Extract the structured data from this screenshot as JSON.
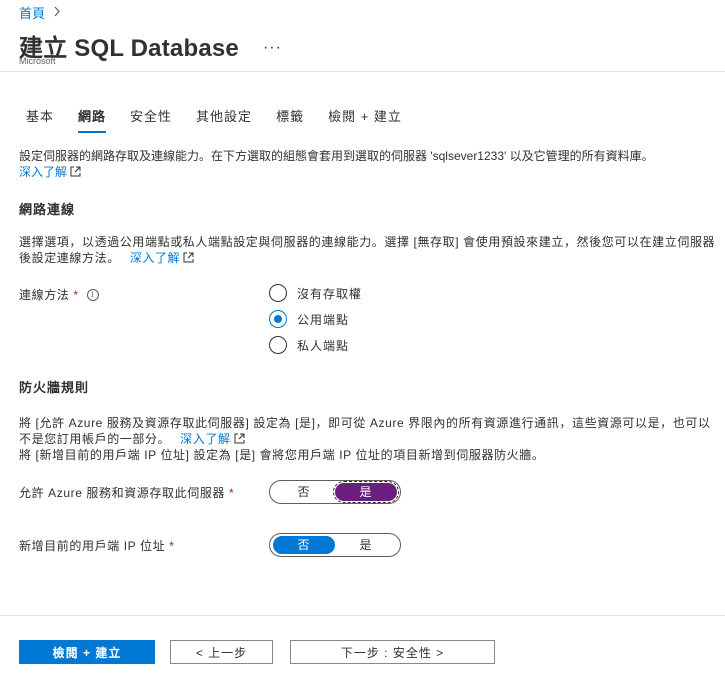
{
  "breadcrumb": {
    "home": "首頁"
  },
  "header": {
    "title": "建立 SQL Database",
    "more": "···",
    "publisher": "Microsoft"
  },
  "tabs": [
    {
      "label": "基本"
    },
    {
      "label": "網路",
      "active": true
    },
    {
      "label": "安全性"
    },
    {
      "label": "其他設定"
    },
    {
      "label": "標籤"
    },
    {
      "label": "檢閱 + 建立"
    }
  ],
  "intro": {
    "text": "設定伺服器的網路存取及連線能力。在下方選取的組態會套用到選取的伺服器 'sqlsever1233' 以及它管理的所有資料庫。",
    "link": "深入了解"
  },
  "network_connectivity": {
    "title": "網路連線",
    "description": "選擇選項，以透過公用端點或私人端點設定與伺服器的連線能力。選擇 [無存取] 會使用預設來建立，然後您可以在建立伺服器後設定連線方法。",
    "link": "深入了解",
    "method_label": "連線方法",
    "required": "*",
    "info_icon": "i",
    "options": [
      {
        "label": "沒有存取權",
        "checked": false
      },
      {
        "label": "公用端點",
        "checked": true
      },
      {
        "label": "私人端點",
        "checked": false
      }
    ]
  },
  "firewall": {
    "title": "防火牆規則",
    "description": "將 [允許 Azure 服務及資源存取此伺服器] 設定為 [是]，即可從 Azure 界限內的所有資源進行通訊，這些資源可以是，也可以不是您訂用帳戶的一部分。",
    "link": "深入了解",
    "description2": "將 [新增目前的用戶端 IP 位址] 設定為 [是] 會將您用戶端 IP 位址的項目新增到伺服器防火牆。",
    "allow_azure": {
      "label": "允許 Azure 服務和資源存取此伺服器",
      "required": "*",
      "no": "否",
      "yes": "是",
      "selected": "是"
    },
    "add_client_ip": {
      "label": "新增目前的用戶端 IP 位址",
      "required": "*",
      "no": "否",
      "yes": "是",
      "selected": "否"
    }
  },
  "footer": {
    "review_create": "檢閱 + 建立",
    "previous": "< 上一步",
    "next": "下一步 : 安全性 >"
  },
  "colors": {
    "accent": "#0078d4",
    "toggle_on": "#6b1e7d",
    "required": "#a4262c"
  }
}
